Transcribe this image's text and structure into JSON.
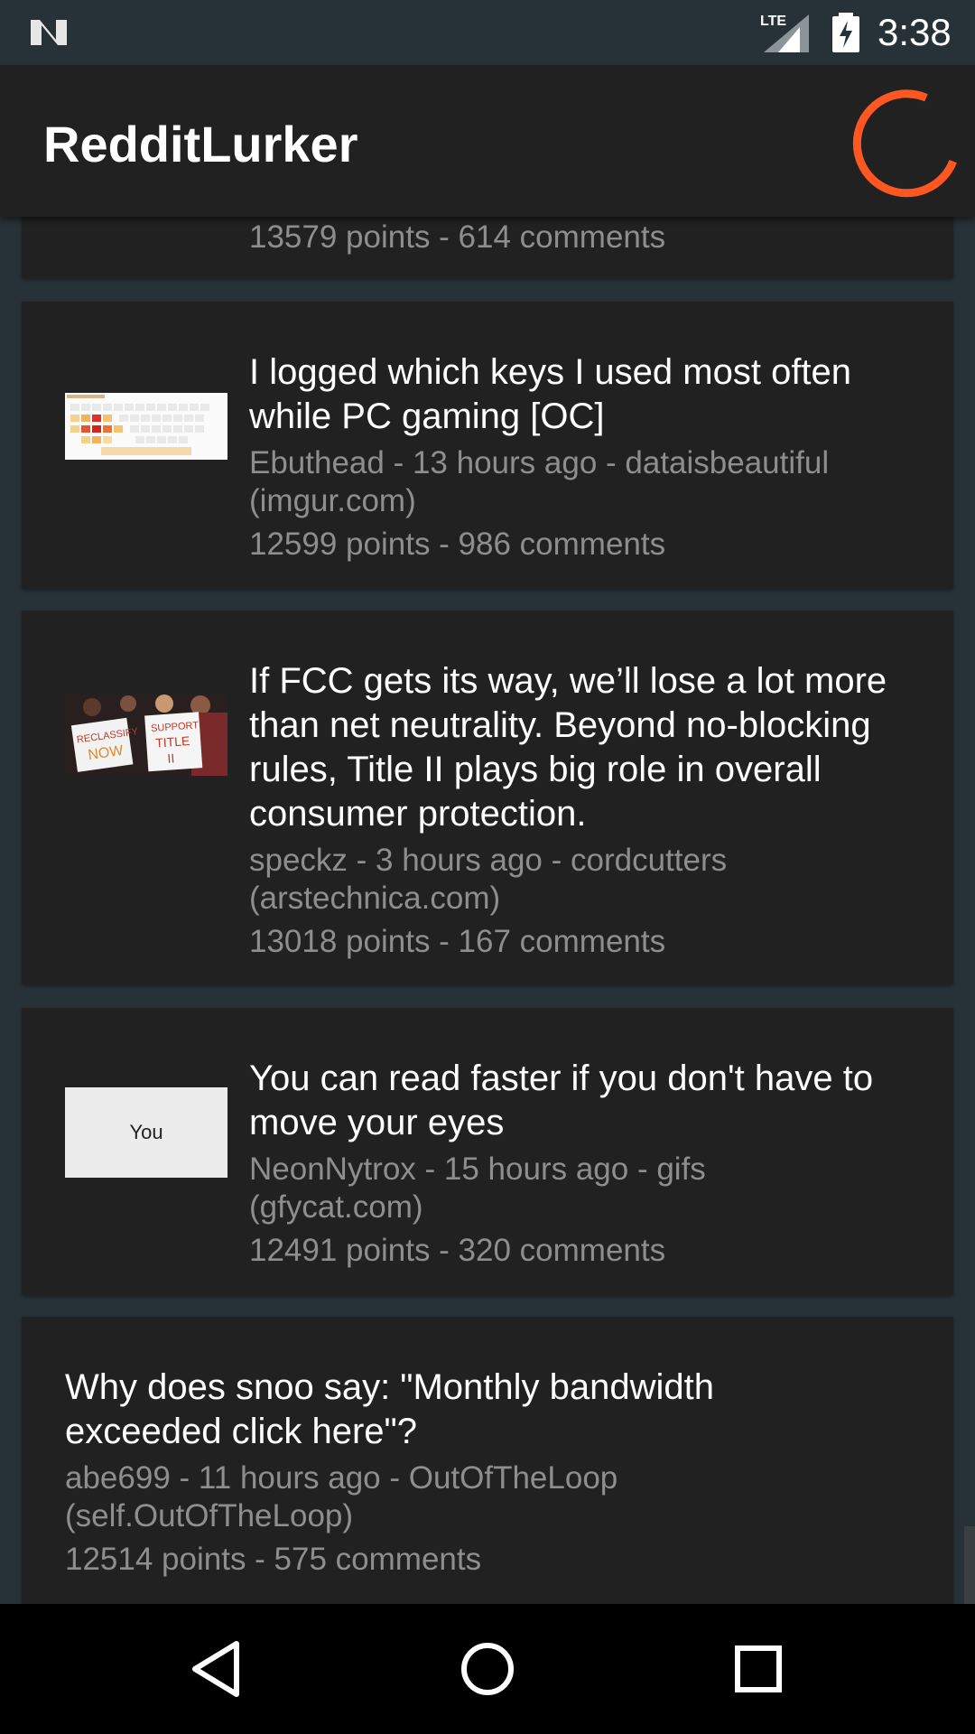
{
  "status_bar": {
    "time": "3:38",
    "network": "LTE",
    "icons": [
      "n-notification-icon",
      "lte-signal-icon",
      "battery-charging-icon"
    ]
  },
  "app_bar": {
    "title": "RedditLurker",
    "loading_indicator": "refresh-spinner-icon",
    "accent_color": "#ff5722"
  },
  "posts": [
    {
      "stats": "13579 points - 614 comments"
    },
    {
      "title": "I logged which keys I used most often while PC gaming [OC]",
      "meta": "Ebuthead - 13 hours ago - dataisbeautiful",
      "domain": "(imgur.com)",
      "stats": "12599 points - 986 comments",
      "thumbnail": "keyboard-heatmap-thumbnail"
    },
    {
      "title": "If FCC gets its way, we’ll lose a lot more than net neutrality. Beyond no-blocking rules, Title II plays big role in overall consumer protection.",
      "meta": "speckz - 3 hours ago - cordcutters",
      "domain": "(arstechnica.com)",
      "stats": "13018 points - 167 comments",
      "thumbnail": "protest-signs-thumbnail",
      "thumb_sign_left": "RECLASSIFY NOW",
      "thumb_sign_right": "SUPPORT TITLE II"
    },
    {
      "title": "You can read faster if you don't have to move your eyes",
      "meta": "NeonNytrox - 15 hours ago - gifs",
      "domain": "(gfycat.com)",
      "stats": "12491 points - 320 comments",
      "thumbnail": "text-preview-thumbnail",
      "thumb_text": "You"
    },
    {
      "title": "Why does snoo say: \"Monthly bandwidth exceeded click here\"?",
      "meta": "abe699 - 11 hours ago - OutOfTheLoop",
      "domain": "(self.OutOfTheLoop)",
      "stats": "12514 points - 575 comments"
    }
  ],
  "nav_bar": {
    "buttons": [
      "back-icon",
      "home-icon",
      "recents-icon"
    ]
  }
}
